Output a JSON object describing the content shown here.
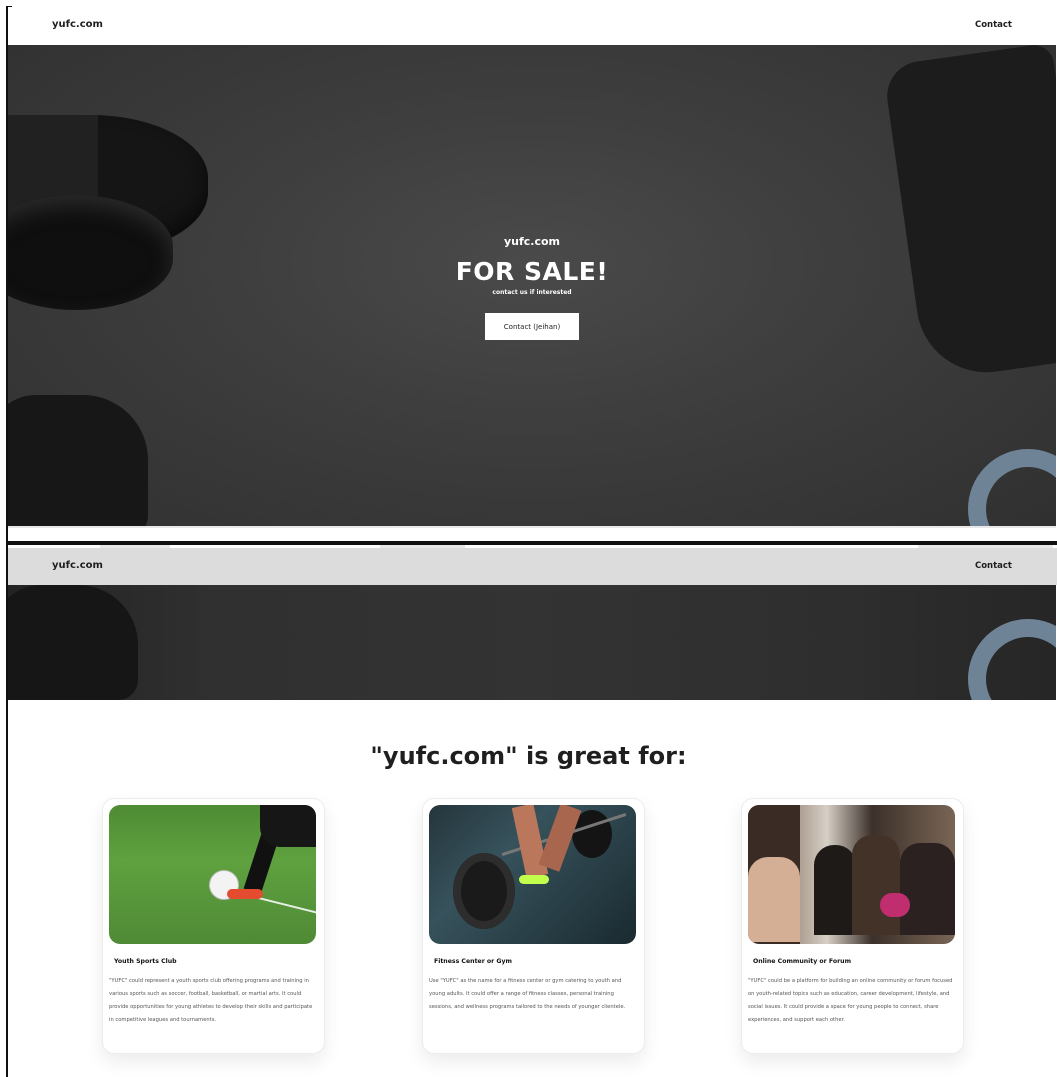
{
  "top_section": {
    "brand": "yufc.com",
    "nav_contact": "Contact",
    "hero_brand": "yufc.com",
    "hero_title": "FOR SALE!",
    "hero_subtitle": "contact us if interested",
    "hero_button": "Contact (Jeihan)"
  },
  "second_section": {
    "brand": "yufc.com",
    "nav_contact": "Contact",
    "heading": "\"yufc.com\" is great for:"
  },
  "cards": [
    {
      "title": "Youth Sports Club",
      "description": "\"YUFC\" could represent a youth sports club offering programs and training in various sports such as soccer, football, basketball, or martial arts. It could provide opportunities for young athletes to develop their skills and participate in competitive leagues and tournaments."
    },
    {
      "title": "Fitness Center or Gym",
      "description": "Use \"YUFC\" as the name for a fitness center or gym catering to youth and young adults. It could offer a range of fitness classes, personal training sessions, and wellness programs tailored to the needs of younger clientele."
    },
    {
      "title": "Online Community or Forum",
      "description": "\"YUFC\" could be a platform for building an online community or forum focused on youth-related topics such as education, career development, lifestyle, and social issues. It could provide a space for young people to connect, share experiences, and support each other."
    }
  ],
  "icons": [
    "dumbbell-icon",
    "glove-icon",
    "ring-weight-icon",
    "soccer-photo-icon",
    "barbell-photo-icon",
    "community-photo-icon"
  ],
  "colors": {
    "hero_text": "#ffffff",
    "text_dark": "#1f1f1f",
    "card_border": "#ececec",
    "ring_blue": "#6f8396"
  }
}
